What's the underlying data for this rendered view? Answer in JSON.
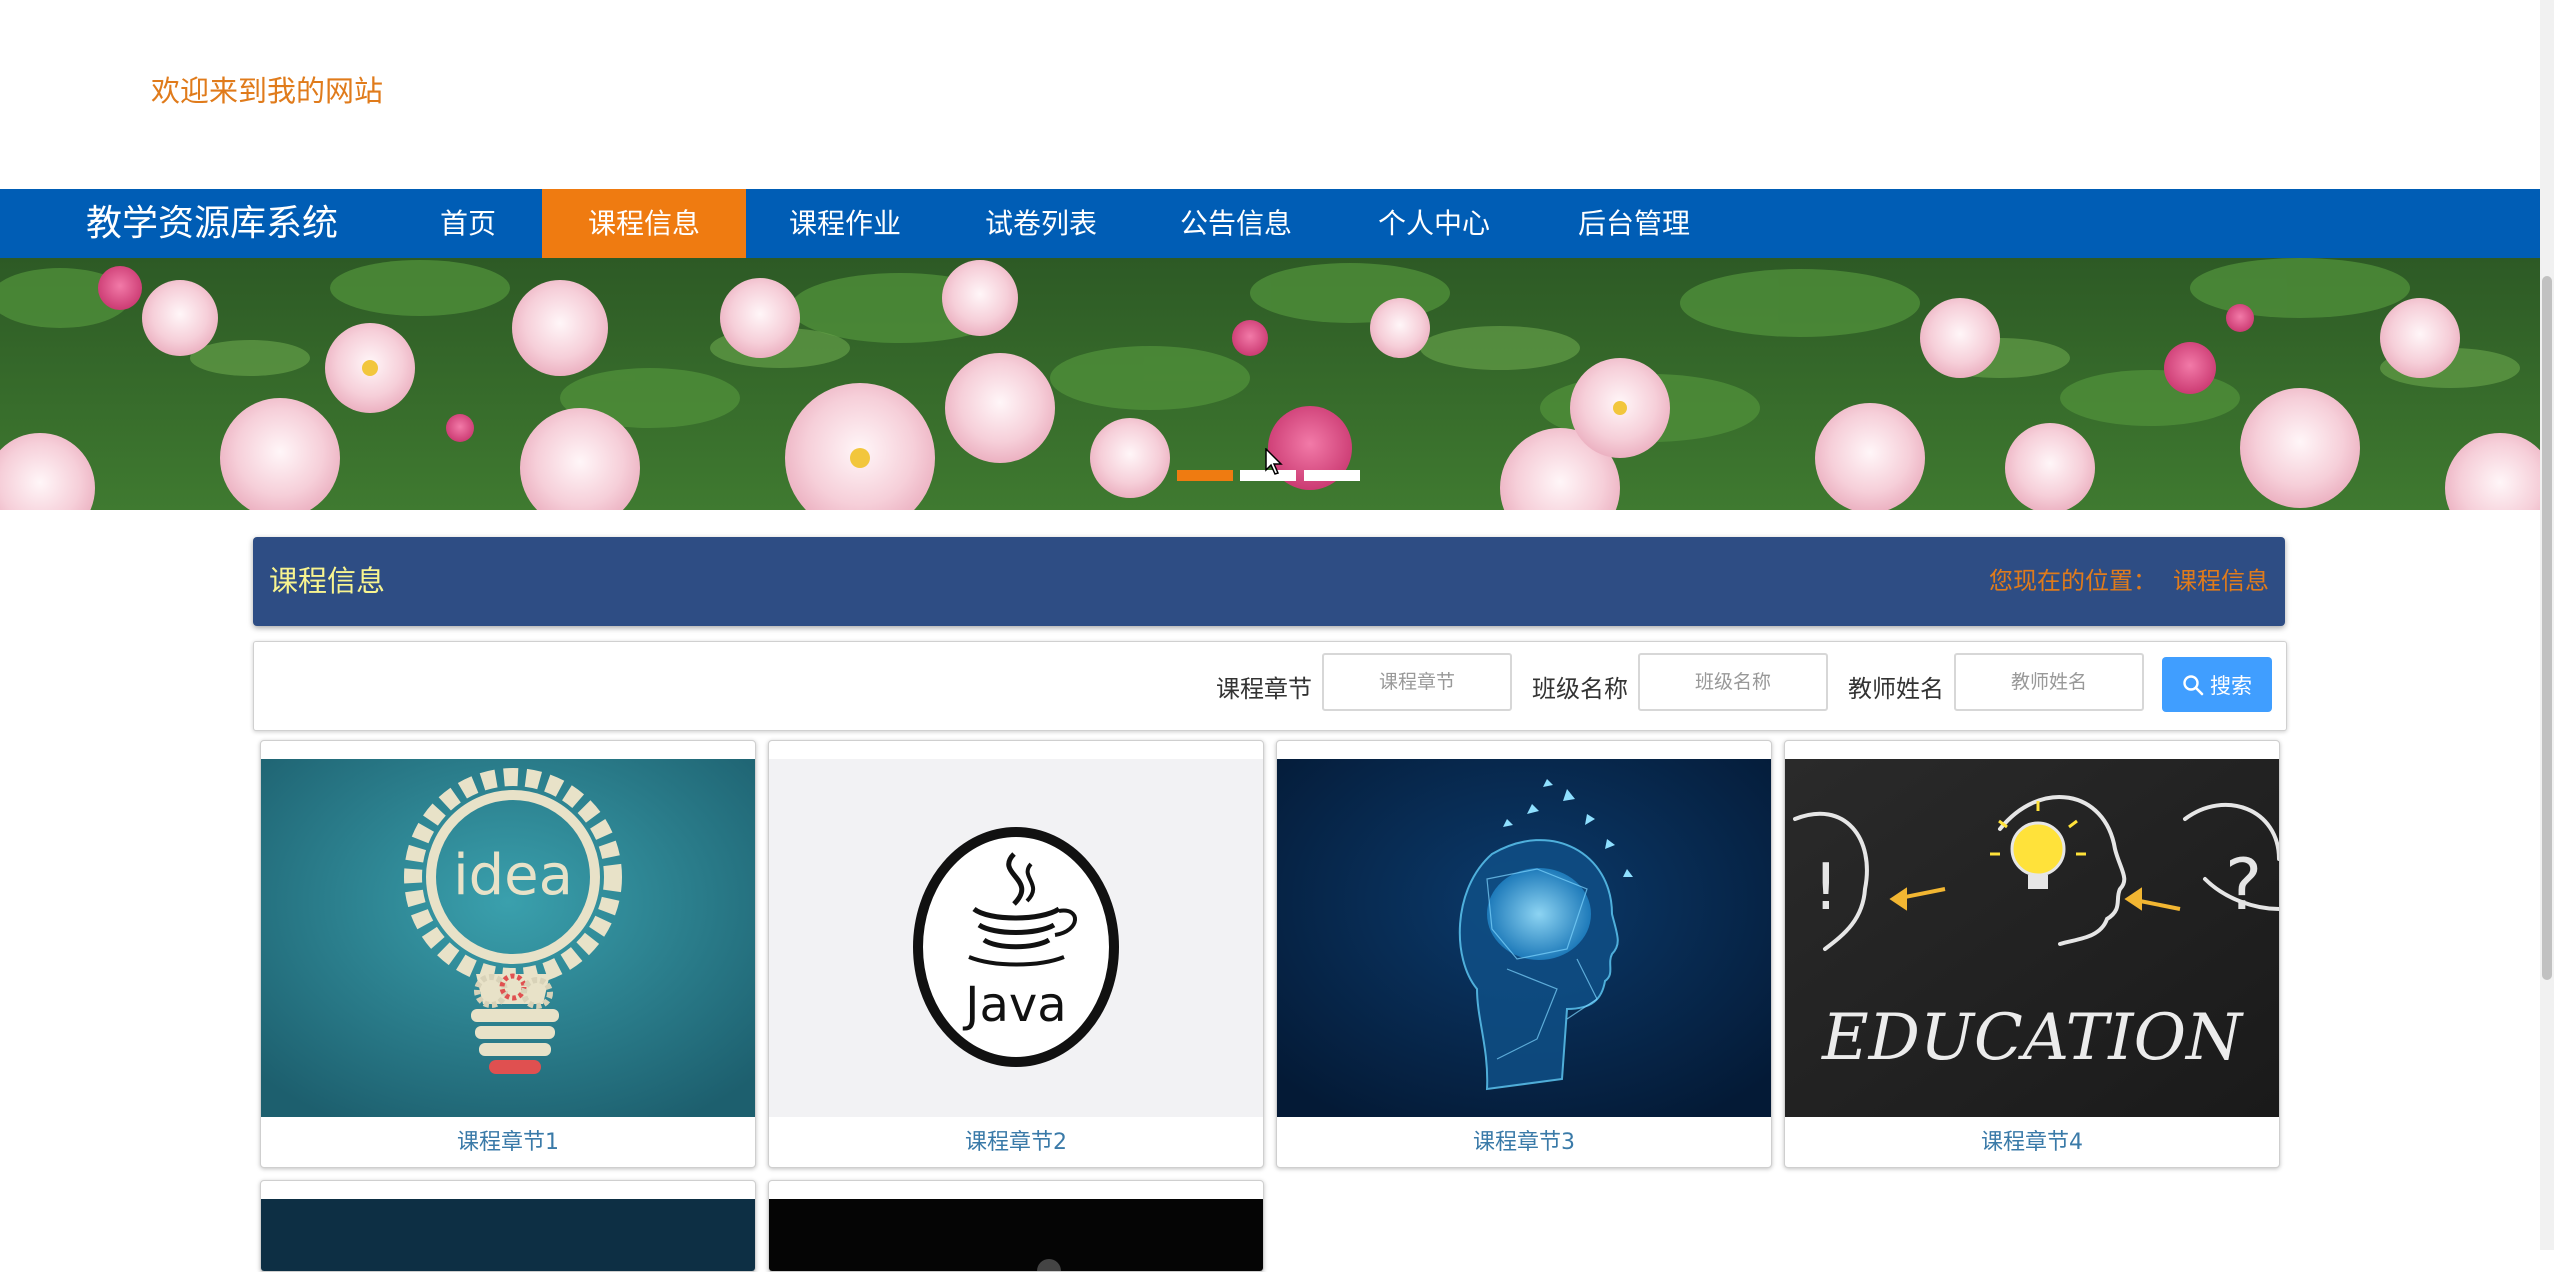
{
  "header": {
    "welcome": "欢迎来到我的网站"
  },
  "nav": {
    "brand": "教学资源库系统",
    "items": [
      "首页",
      "课程信息",
      "课程作业",
      "试卷列表",
      "公告信息",
      "个人中心",
      "后台管理"
    ],
    "active": "课程信息"
  },
  "carousel": {
    "slide_count": 3,
    "active_index": 0
  },
  "page": {
    "title": "课程信息",
    "breadcrumb_prefix": "您现在的位置：",
    "breadcrumb_current": "课程信息"
  },
  "search": {
    "fields": [
      {
        "label": "课程章节",
        "placeholder": "课程章节"
      },
      {
        "label": "班级名称",
        "placeholder": "班级名称"
      },
      {
        "label": "教师姓名",
        "placeholder": "教师姓名"
      }
    ],
    "button_label": "搜索"
  },
  "cards": [
    {
      "title": "课程章节1",
      "image": "idea-lightbulb-gear"
    },
    {
      "title": "课程章节2",
      "image": "java-logo"
    },
    {
      "title": "课程章节3",
      "image": "digital-brain-head"
    },
    {
      "title": "课程章节4",
      "image": "education-chalkboard"
    }
  ],
  "colors": {
    "nav_bg": "#005db5",
    "nav_active": "#ef7b11",
    "title_bar_bg": "#2e4d84",
    "title_text": "#f8f48f",
    "accent_orange": "#e07b1b",
    "search_button": "#409eff",
    "card_caption": "#3a7aa8"
  }
}
